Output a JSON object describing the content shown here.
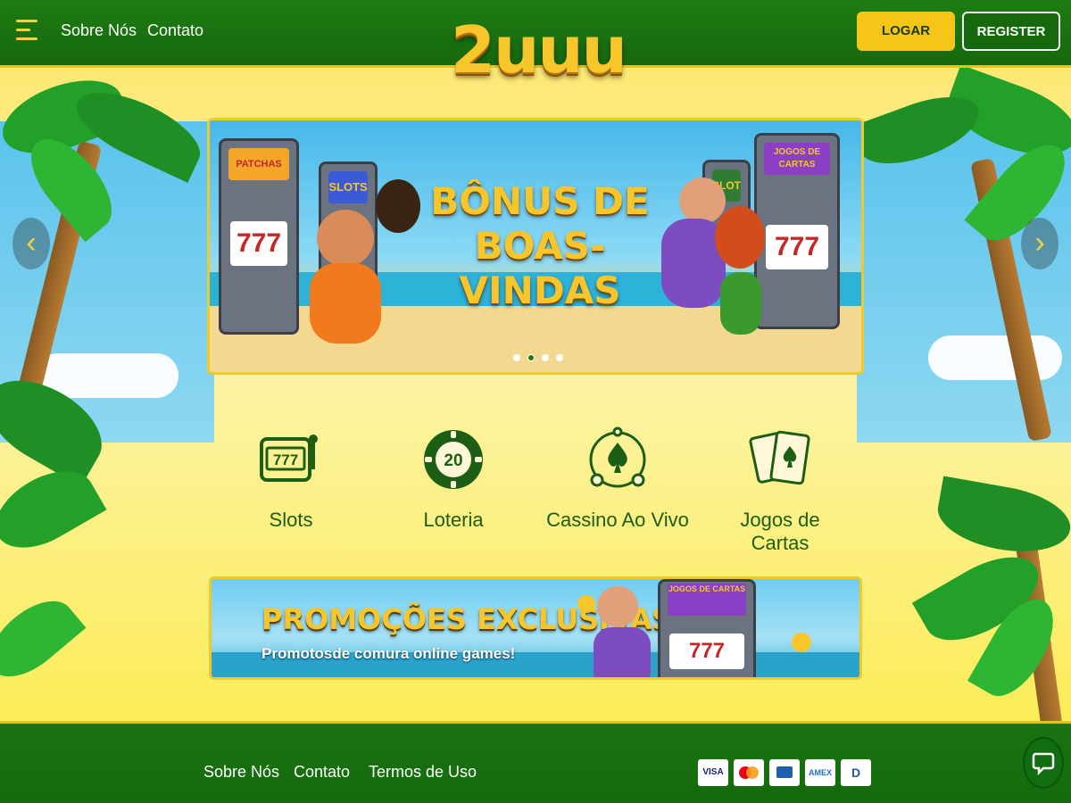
{
  "header": {
    "logo": "2uuu",
    "nav": [
      "Sobre Nós",
      "Contato"
    ],
    "login_label": "LOGAR",
    "register_label": "REGISTER"
  },
  "carousel": {
    "title_line1": "BÔNUS DE",
    "title_line2": "BOAS-VINDAS",
    "machine_labels": [
      "PATCHAS",
      "SLOTS",
      "SLOT",
      "JOGOS DE CARTAS"
    ],
    "slides": 4,
    "active_slide": 2
  },
  "categories": [
    {
      "label": "Slots",
      "icon": "slot-machine-icon"
    },
    {
      "label": "Loteria",
      "icon": "lottery-ball-icon",
      "number": "20"
    },
    {
      "label": "Cassino Ao Vivo",
      "icon": "live-casino-icon"
    },
    {
      "label": "Jogos de Cartas",
      "icon": "playing-cards-icon"
    }
  ],
  "promo": {
    "title": "PROMOÇÕES EXCLUSIVAS",
    "subtitle": "Promotosde comura online games!",
    "machine_label": "JOGOS DE CARTAS"
  },
  "footer": {
    "links": [
      "Sobre Nós",
      "Contato",
      "Termos de Uso"
    ],
    "payments": [
      {
        "name": "visa-icon",
        "label": "VISA"
      },
      {
        "name": "mastercard-icon",
        "label": ""
      },
      {
        "name": "card-icon",
        "label": ""
      },
      {
        "name": "amex-icon",
        "label": "AMEX"
      },
      {
        "name": "diners-icon",
        "label": "D"
      }
    ]
  },
  "colors": {
    "brand_green": "#17680d",
    "accent_yellow": "#f5c518",
    "category_green": "#1b5e14"
  }
}
